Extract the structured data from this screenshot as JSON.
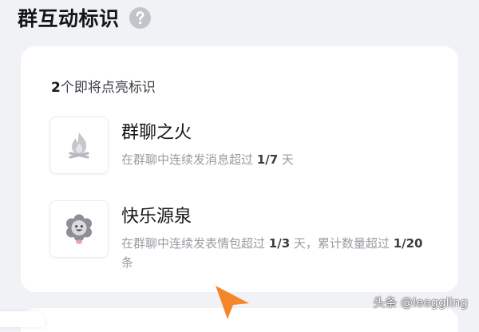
{
  "header": {
    "title": "群互动标识",
    "help_icon": "question-circle-icon"
  },
  "card": {
    "subtitle_count": "2",
    "subtitle_text": "个即将点亮标识",
    "items": [
      {
        "name": "群聊之火",
        "icon": "campfire-icon",
        "desc_prefix": "在群聊中连续发消息超过 ",
        "desc_value": "1/7",
        "desc_suffix": " 天"
      },
      {
        "name": "快乐源泉",
        "icon": "happy-flower-icon",
        "desc_prefix": "在群聊中连续发表情包超过 ",
        "desc_value": "1/3",
        "desc_middle": " 天，累计数量超过 ",
        "desc_value2": "1/20",
        "desc_suffix": "条"
      }
    ]
  },
  "watermark": "头条 @leeggling",
  "colors": {
    "background": "#f1f2f6",
    "card": "#ffffff",
    "help_icon": "#c2c4ca",
    "arrow": "#f5872a"
  }
}
